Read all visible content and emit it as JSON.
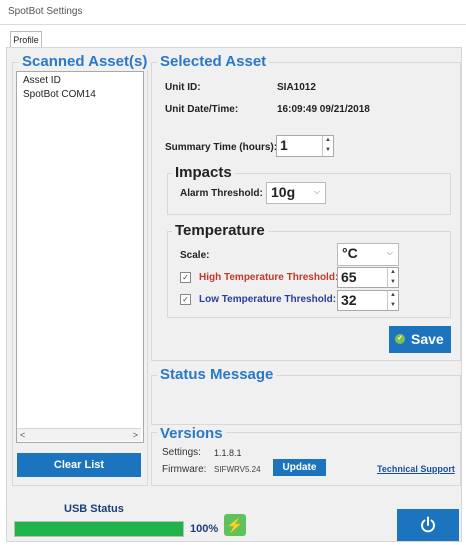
{
  "window": {
    "title": "SpotBot Settings"
  },
  "tabs": [
    {
      "label": "Profile"
    }
  ],
  "scanned_assets": {
    "title": "Scanned Asset(s)",
    "items": [
      "Asset ID",
      "SpotBot COM14"
    ],
    "clear_label": "Clear List"
  },
  "selected_asset": {
    "title": "Selected Asset",
    "unit_id_label": "Unit ID:",
    "unit_id_value": "SIA1012",
    "unit_datetime_label": "Unit Date/Time:",
    "unit_datetime_value": "16:09:49 09/21/2018",
    "summary_time_label": "Summary Time (hours):",
    "summary_time_value": "1"
  },
  "impacts": {
    "title": "Impacts",
    "alarm_threshold_label": "Alarm Threshold:",
    "alarm_threshold_value": "10g"
  },
  "temperature": {
    "title": "Temperature",
    "scale_label": "Scale:",
    "scale_value": "°C",
    "high_label": "High Temperature Threshold:",
    "high_value": "65",
    "low_label": "Low Temperature Threshold:",
    "low_value": "32"
  },
  "save_label": "Save",
  "status_message": {
    "title": "Status Message"
  },
  "versions": {
    "title": "Versions",
    "settings_label": "Settings:",
    "settings_value": "1.1.8.1",
    "firmware_label": "Firmware:",
    "firmware_value": "SIFWRV5.24",
    "update_label": "Update",
    "support_label": "Technical Support"
  },
  "usb": {
    "label": "USB Status",
    "progress": 100,
    "progress_text": "100%"
  },
  "colors": {
    "accent": "#1c73be",
    "heading": "#2b78c6",
    "high_temp": "#c0392b",
    "low_temp": "#2c3e9e",
    "progress": "#1fb34a"
  }
}
